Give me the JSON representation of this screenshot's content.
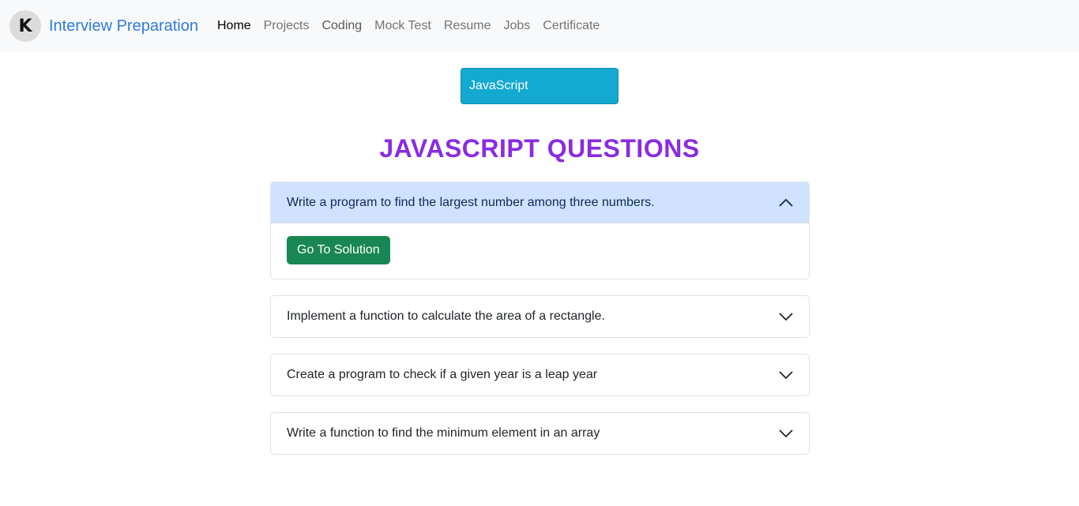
{
  "navbar": {
    "logo_letter": "K",
    "brand": "Interview Preparation",
    "links": [
      "Home",
      "Projects",
      "Coding",
      "Mock Test",
      "Resume",
      "Jobs",
      "Certificate"
    ]
  },
  "language_select": {
    "selected": "JavaScript"
  },
  "page_title": "JAVASCRIPT QUESTIONS",
  "questions": [
    {
      "text": "Write a program to find the largest number among three numbers.",
      "button": "Go To Solution"
    },
    {
      "text": "Implement a function to calculate the area of a rectangle."
    },
    {
      "text": "Create a program to check if a given year is a leap year"
    },
    {
      "text": "Write a function to find the minimum element in an array"
    }
  ],
  "colors": {
    "brand": "#2f7bd8",
    "title": "#8a2be2",
    "select_bg": "#14a9d0",
    "open_header_bg": "#cfe2ff",
    "button_bg": "#198754"
  }
}
